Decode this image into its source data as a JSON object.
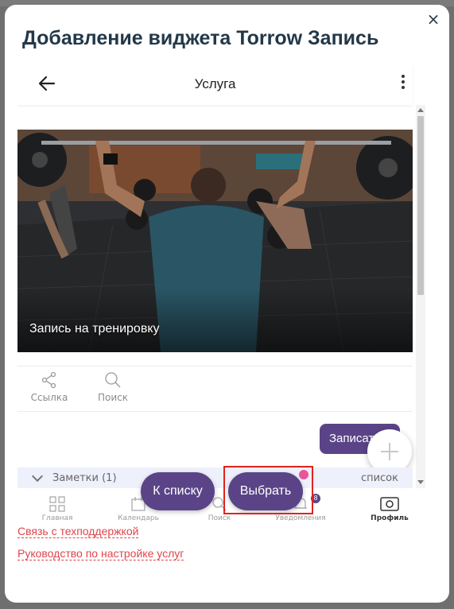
{
  "modal": {
    "title": "Добавление виджета Torrow Запись",
    "close_label": "×"
  },
  "app": {
    "header_title": "Услуга",
    "hero_caption": "Запись на тренировку",
    "actions": [
      {
        "label": "Ссылка",
        "icon": "share-icon"
      },
      {
        "label": "Поиск",
        "icon": "search-icon"
      }
    ],
    "book_button": "Записаться",
    "notes": {
      "label": "Заметки (1)",
      "list_label": "список"
    }
  },
  "tabbar": {
    "items": [
      {
        "label": "Главная",
        "icon": "home-grid-icon"
      },
      {
        "label": "Календарь",
        "icon": "calendar-icon"
      },
      {
        "label": "Поиск",
        "icon": "search-icon"
      },
      {
        "label": "Уведомления",
        "icon": "bell-icon"
      },
      {
        "label": "Профиль",
        "icon": "profile-card-icon"
      }
    ],
    "notification_count": "8"
  },
  "floating_buttons": {
    "to_list": "К списку",
    "select": "Выбрать"
  },
  "links": {
    "support": "Связь с техподдержкой",
    "setup_guide": "Руководство по настройке услуг"
  },
  "colors": {
    "accent": "#5a4487",
    "title": "#233848",
    "link": "#e0454b",
    "highlight_box": "#e0231e",
    "pink_dot": "#e8559b"
  }
}
